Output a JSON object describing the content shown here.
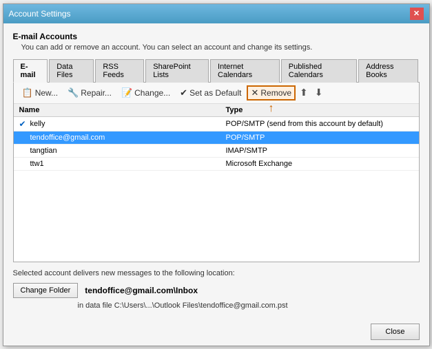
{
  "titleBar": {
    "title": "Account Settings",
    "closeLabel": "✕"
  },
  "header": {
    "mainTitle": "E-mail Accounts",
    "subtitle": "You can add or remove an account. You can select an account and change its settings."
  },
  "tabs": [
    {
      "id": "email",
      "label": "E-mail",
      "active": true
    },
    {
      "id": "datafiles",
      "label": "Data Files",
      "active": false
    },
    {
      "id": "rssfeeds",
      "label": "RSS Feeds",
      "active": false
    },
    {
      "id": "sharepointlists",
      "label": "SharePoint Lists",
      "active": false
    },
    {
      "id": "internetcalendars",
      "label": "Internet Calendars",
      "active": false
    },
    {
      "id": "publishedcalendars",
      "label": "Published Calendars",
      "active": false
    },
    {
      "id": "addressbooks",
      "label": "Address Books",
      "active": false
    }
  ],
  "toolbar": {
    "newLabel": "New...",
    "repairLabel": "Repair...",
    "changeLabel": "Change...",
    "setDefaultLabel": "Set as Default",
    "removeLabel": "Remove"
  },
  "tableColumns": {
    "name": "Name",
    "type": "Type"
  },
  "accounts": [
    {
      "id": 1,
      "name": "kelly",
      "type": "POP/SMTP (send from this account by default)",
      "selected": false,
      "checked": true
    },
    {
      "id": 2,
      "name": "tendoffice@gmail.com",
      "type": "POP/SMTP",
      "selected": true,
      "checked": false
    },
    {
      "id": 3,
      "name": "tangtian",
      "type": "IMAP/SMTP",
      "selected": false,
      "checked": false
    },
    {
      "id": 4,
      "name": "ttw1",
      "type": "Microsoft Exchange",
      "selected": false,
      "checked": false
    }
  ],
  "footer": {
    "deliveryLabel": "Selected account delivers new messages to the following location:",
    "changeFolderLabel": "Change Folder",
    "folderName": "tendoffice@gmail.com\\Inbox",
    "dataFilePath": "in data file C:\\Users\\...\\Outlook Files\\tendoffice@gmail.com.pst"
  },
  "closeButton": "Close"
}
